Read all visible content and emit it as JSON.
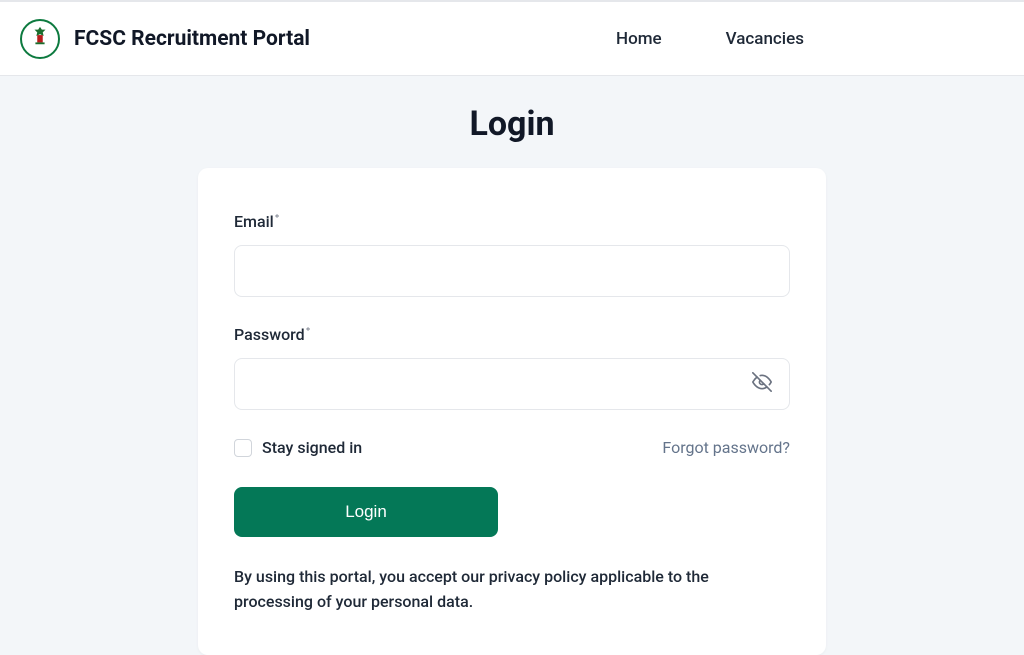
{
  "header": {
    "site_title": "FCSC Recruitment Portal",
    "nav": {
      "home": "Home",
      "vacancies": "Vacancies"
    }
  },
  "page": {
    "title": "Login"
  },
  "form": {
    "email_label": "Email",
    "password_label": "Password",
    "stay_signed_in": "Stay signed in",
    "forgot_password": "Forgot password?",
    "login_button": "Login",
    "notice": "By using this portal, you accept our privacy policy applicable to the processing of your personal data."
  }
}
